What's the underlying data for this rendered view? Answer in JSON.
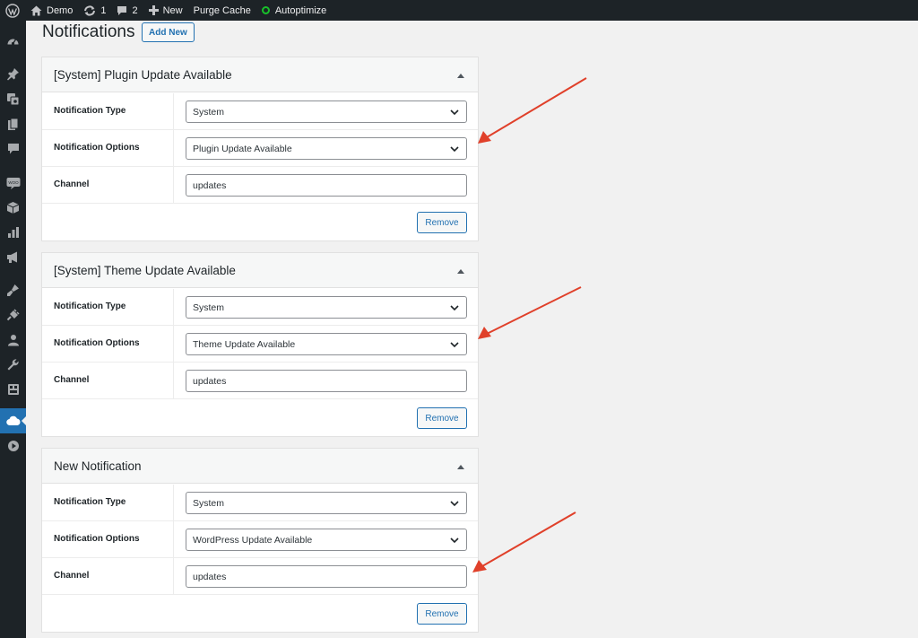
{
  "adminbar": {
    "site_name": "Demo",
    "updates_count": "1",
    "comments_count": "2",
    "new_label": "New",
    "purge_label": "Purge Cache",
    "autoptimize_label": "Autoptimize"
  },
  "sidebar": {
    "icons": [
      "dashboard-icon",
      "pin-icon",
      "media-icon",
      "pages-icon",
      "comments-icon",
      "woo-icon",
      "products-icon",
      "analytics-icon",
      "marketing-icon",
      "appearance-icon",
      "plugins-icon",
      "users-icon",
      "tools-icon",
      "settings-icon",
      "cloud-icon",
      "play-icon"
    ],
    "current": "cloud-icon"
  },
  "page": {
    "title": "Notifications",
    "add_new": "Add New"
  },
  "labels": {
    "type": "Notification Type",
    "options": "Notification Options",
    "channel": "Channel",
    "remove": "Remove"
  },
  "notifications": [
    {
      "title": "[System] Plugin Update Available",
      "type": "System",
      "option": "Plugin Update Available",
      "channel": "updates"
    },
    {
      "title": "[System] Theme Update Available",
      "type": "System",
      "option": "Theme Update Available",
      "channel": "updates"
    },
    {
      "title": "New Notification",
      "type": "System",
      "option": "WordPress Update Available",
      "channel": "updates"
    }
  ],
  "colors": {
    "adminbar": "#1d2327",
    "accent": "#2271b1",
    "annotation_arrow": "#e0402a",
    "status_ok": "#18c12a"
  }
}
